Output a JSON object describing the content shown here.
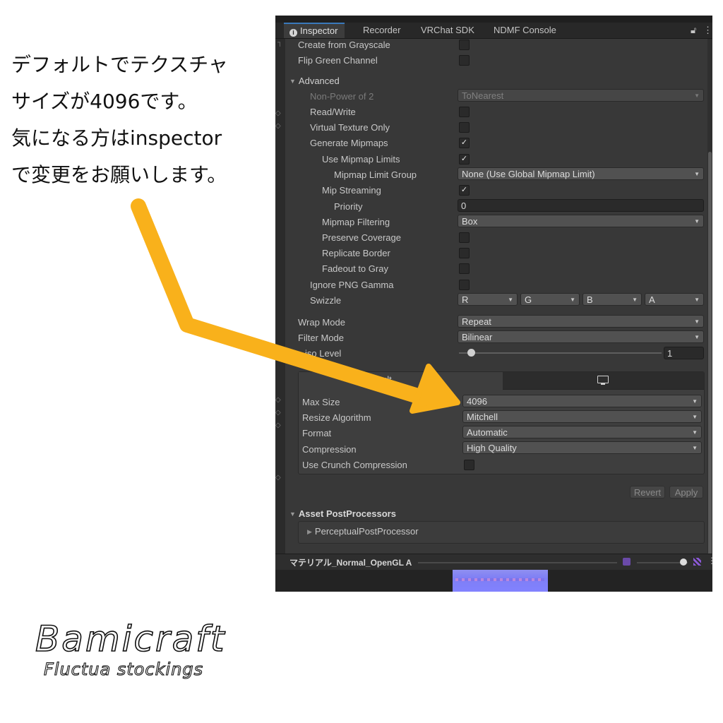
{
  "note_lines": [
    "デフォルトでテクスチャ",
    "サイズが4096です。",
    "気になる方はinspector",
    "で変更をお願いします。"
  ],
  "tabs": [
    "Inspector",
    "Recorder",
    "VRChat SDK",
    "NDMF Console"
  ],
  "tab_icons": {
    "lock": "lock-icon",
    "menu": "kebab-menu-icon"
  },
  "settings": {
    "create_from_grayscale": "Create from Grayscale",
    "flip_green": "Flip Green Channel",
    "advanced": "Advanced",
    "npot_label": "Non-Power of 2",
    "npot_value": "ToNearest",
    "read_write": "Read/Write",
    "virtual_texture": "Virtual Texture Only",
    "generate_mipmaps": "Generate Mipmaps",
    "use_mipmap_limits": "Use Mipmap Limits",
    "mipmap_limit_group_label": "Mipmap Limit Group",
    "mipmap_limit_group_value": "None (Use Global Mipmap Limit)",
    "mip_streaming": "Mip Streaming",
    "priority_label": "Priority",
    "priority_value": "0",
    "mipmap_filtering_label": "Mipmap Filtering",
    "mipmap_filtering_value": "Box",
    "preserve_coverage": "Preserve Coverage",
    "replicate_border": "Replicate Border",
    "fadeout_to_gray": "Fadeout to Gray",
    "ignore_png_gamma": "Ignore PNG Gamma",
    "swizzle_label": "Swizzle",
    "swizzle_values": [
      "R",
      "G",
      "B",
      "A"
    ],
    "wrap_mode_label": "Wrap Mode",
    "wrap_mode_value": "Repeat",
    "filter_mode_label": "Filter Mode",
    "filter_mode_value": "Bilinear",
    "aniso_label_visible": "iso Level",
    "aniso_value": "1",
    "aniso_fraction": 0.06
  },
  "platform": {
    "default_tab_visible": "ult",
    "pc_tab_icon": "monitor-icon",
    "max_size_label": "Max Size",
    "max_size_value": "4096",
    "resize_label": "Resize Algorithm",
    "resize_value": "Mitchell",
    "format_label": "Format",
    "format_value": "Automatic",
    "compression_label": "Compression",
    "compression_value": "High Quality",
    "crunch_label": "Use Crunch Compression"
  },
  "buttons": {
    "revert": "Revert",
    "apply": "Apply"
  },
  "post_processors": {
    "title": "Asset PostProcessors",
    "item": "PerceptualPostProcessor"
  },
  "preview": {
    "title": "マテリアル_Normal_OpenGL A"
  },
  "logo": {
    "title": "Bamicraft",
    "subtitle": "Fluctua stockings"
  },
  "colors": {
    "arrow": "#F9B11B",
    "window_bg": "#383838",
    "accent_tab": "#3A79BB"
  }
}
